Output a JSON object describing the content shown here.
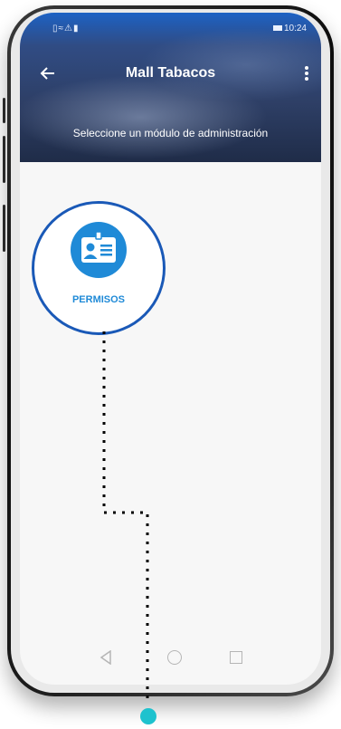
{
  "status_bar": {
    "left_icons": "▯≈⚠▮",
    "time": "10:24"
  },
  "app_bar": {
    "title": "Mall Tabacos",
    "back_icon": "arrow-left-icon",
    "menu_icon": "more-vertical-icon"
  },
  "header": {
    "subtitle": "Seleccione un módulo de administración"
  },
  "modules": [
    {
      "label": "PERMISOS",
      "icon": "id-card-icon",
      "highlighted": true
    }
  ],
  "system_nav": {
    "back_icon": "triangle-back-icon",
    "home_icon": "circle-home-icon",
    "recent_icon": "square-recent-icon"
  },
  "colors": {
    "highlight_ring": "#1a59b7",
    "module_icon_bg": "#1f8ad7",
    "guide_dot": "#1ec2ce"
  }
}
